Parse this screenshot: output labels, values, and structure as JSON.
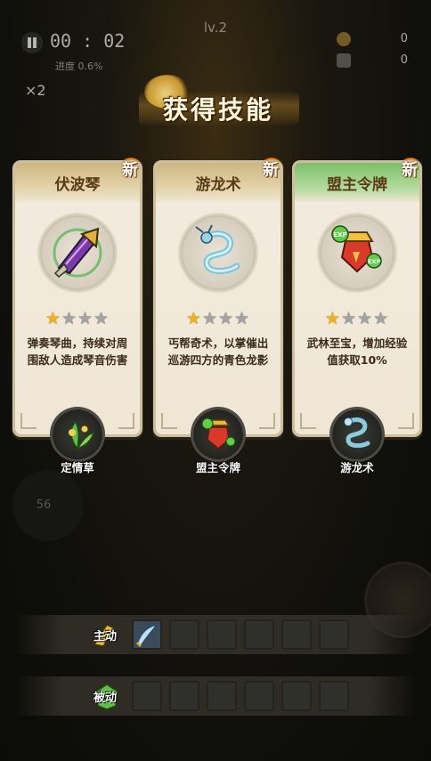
{
  "hud": {
    "timer": "00 : 02",
    "progress": "进度  0.6%",
    "level": "lv.2",
    "multiplier": "×2",
    "coins": "0",
    "gems": "0",
    "joystick_value": "56"
  },
  "banner": {
    "title": "获得技能"
  },
  "cards": [
    {
      "title": "伏波琴",
      "new_badge": "新",
      "icon": "purple-sword-icon",
      "stars": 1,
      "max_stars": 4,
      "desc": "弹奏琴曲，持续对周围敌人造成琴音伤害",
      "combo_icon": "herb-icon",
      "combo_label": "定情草"
    },
    {
      "title": "游龙术",
      "new_badge": "新",
      "icon": "blue-dragon-icon",
      "stars": 1,
      "max_stars": 4,
      "desc": "丐帮奇术，以掌催出巡游四方的青色龙影",
      "combo_icon": "token-icon",
      "combo_label": "盟主令牌"
    },
    {
      "title": "盟主令牌",
      "new_badge": "新",
      "icon": "exp-token-icon",
      "stars": 1,
      "max_stars": 4,
      "desc": "武林至宝，增加经验值获取10%",
      "combo_icon": "dragon-icon",
      "combo_label": "游龙术"
    }
  ],
  "skill_bars": {
    "active_label": "主动",
    "passive_label": "被动"
  }
}
